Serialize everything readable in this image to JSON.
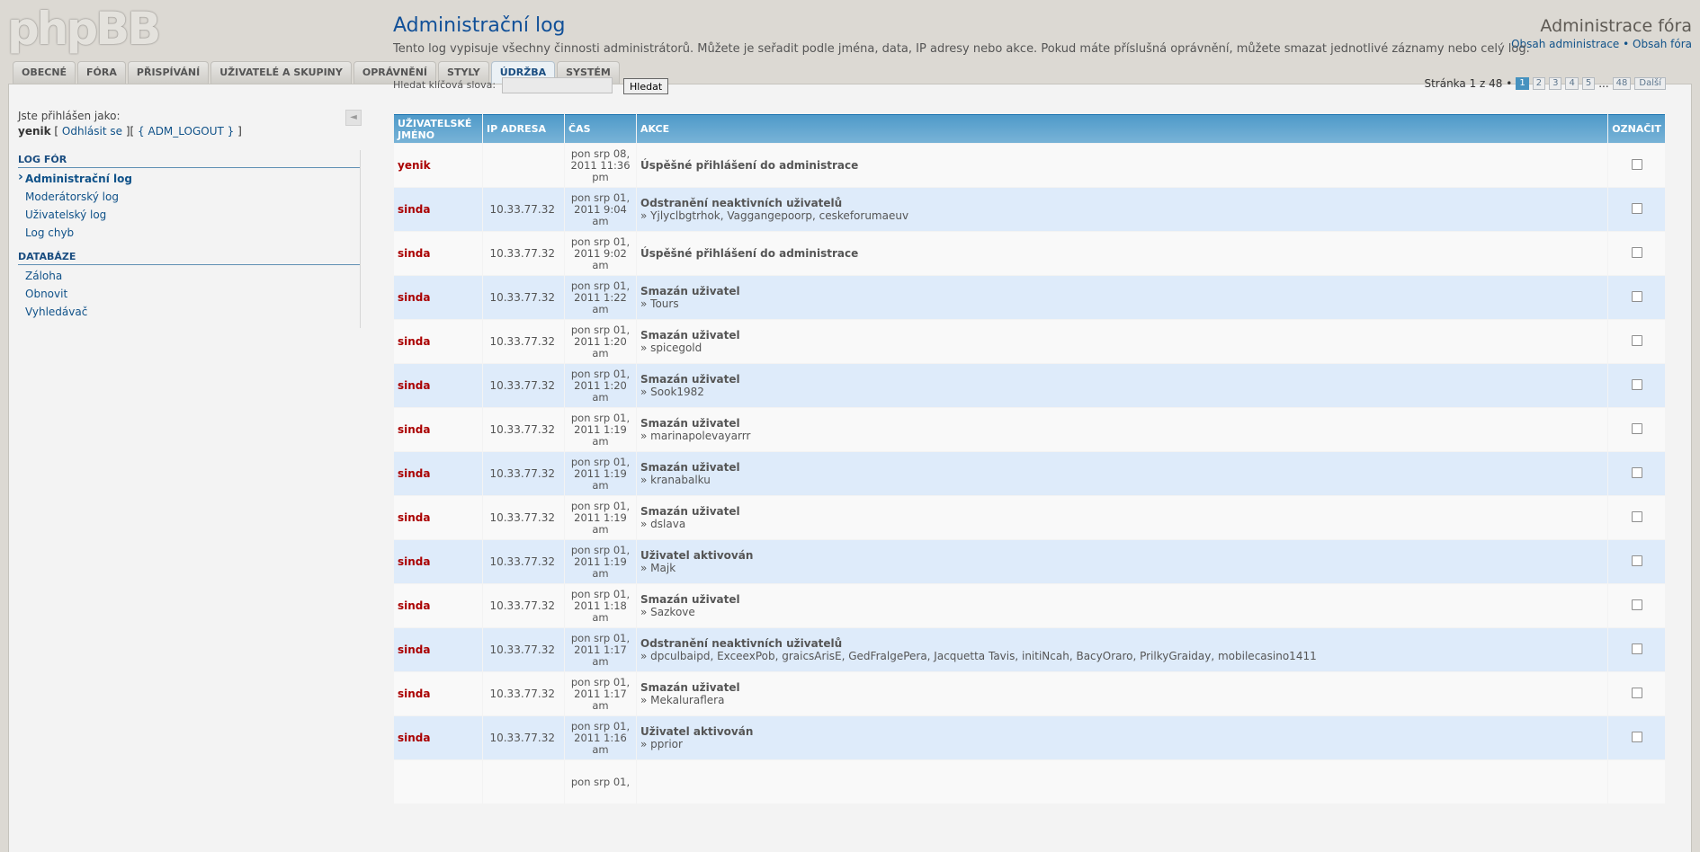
{
  "header": {
    "logo": "phpBB",
    "site_title": "Administrace fóra",
    "link_admin_index": "Obsah administrace",
    "separator": "•",
    "link_board_index": "Obsah fóra"
  },
  "tabs": [
    {
      "label": "OBECNÉ"
    },
    {
      "label": "FÓRA"
    },
    {
      "label": "PŘISPÍVÁNÍ"
    },
    {
      "label": "UŽIVATELÉ A SKUPINY"
    },
    {
      "label": "OPRÁVNĚNÍ"
    },
    {
      "label": "STYLY"
    },
    {
      "label": "ÚDRŽBA"
    },
    {
      "label": "SYSTÉM"
    }
  ],
  "sidebar": {
    "logged_in_label": "Jste přihlášen jako:",
    "username": "yenik",
    "logout_open": " [ ",
    "logout_link": "Odhlásit se",
    "logout_mid": " ][ ",
    "adm_logout": "{ ADM_LOGOUT }",
    "logout_close": " ]",
    "collapse_glyph": "◄",
    "sections": [
      {
        "title": "LOG FÓR",
        "items": [
          {
            "label": "Administrační log"
          },
          {
            "label": "Moderátorský log"
          },
          {
            "label": "Uživatelský log"
          },
          {
            "label": "Log chyb"
          }
        ]
      },
      {
        "title": "DATABÁZE",
        "items": [
          {
            "label": "Záloha"
          },
          {
            "label": "Obnovit"
          },
          {
            "label": "Vyhledávač"
          }
        ]
      }
    ]
  },
  "main": {
    "title": "Administrační log",
    "description": "Tento log vypisuje všechny činnosti administrátorů. Můžete je seřadit podle jména, data, IP adresy nebo akce. Pokud máte příslušná oprávnění, můžete smazat jednotlivé záznamy nebo celý log.",
    "search_label": "Hledat klíčová slova:",
    "search_value": "",
    "search_button": "Hledat",
    "pagination": {
      "text": "Stránka 1 z 48 •",
      "pages": [
        "1",
        "2",
        "3",
        "4",
        "5"
      ],
      "ellipsis": "...",
      "last": "48",
      "next": "Další"
    }
  },
  "table": {
    "headers": {
      "user": "UŽIVATELSKÉ JMÉNO",
      "ip": "IP ADRESA",
      "time": "ČAS",
      "action": "AKCE",
      "mark": "OZNAČIT"
    },
    "rows": [
      {
        "user": "yenik",
        "ip": "",
        "time": "pon srp 08, 2011 11:36 pm",
        "action": "Úspěšné přihlášení do administrace",
        "detail": ""
      },
      {
        "user": "sinda",
        "ip": "10.33.77.32",
        "time": "pon srp 01, 2011 9:04 am",
        "action": "Odstranění neaktivních uživatelů",
        "detail": "» Yjlyclbgtrhok, Vaggangepoorp, ceskeforumaeuv"
      },
      {
        "user": "sinda",
        "ip": "10.33.77.32",
        "time": "pon srp 01, 2011 9:02 am",
        "action": "Úspěšné přihlášení do administrace",
        "detail": ""
      },
      {
        "user": "sinda",
        "ip": "10.33.77.32",
        "time": "pon srp 01, 2011 1:22 am",
        "action": "Smazán uživatel",
        "detail": "» Tours"
      },
      {
        "user": "sinda",
        "ip": "10.33.77.32",
        "time": "pon srp 01, 2011 1:20 am",
        "action": "Smazán uživatel",
        "detail": "» spicegold"
      },
      {
        "user": "sinda",
        "ip": "10.33.77.32",
        "time": "pon srp 01, 2011 1:20 am",
        "action": "Smazán uživatel",
        "detail": "» Sook1982"
      },
      {
        "user": "sinda",
        "ip": "10.33.77.32",
        "time": "pon srp 01, 2011 1:19 am",
        "action": "Smazán uživatel",
        "detail": "» marinapolevayarrr"
      },
      {
        "user": "sinda",
        "ip": "10.33.77.32",
        "time": "pon srp 01, 2011 1:19 am",
        "action": "Smazán uživatel",
        "detail": "» kranabalku"
      },
      {
        "user": "sinda",
        "ip": "10.33.77.32",
        "time": "pon srp 01, 2011 1:19 am",
        "action": "Smazán uživatel",
        "detail": "» dslava"
      },
      {
        "user": "sinda",
        "ip": "10.33.77.32",
        "time": "pon srp 01, 2011 1:19 am",
        "action": "Uživatel aktivován",
        "detail": "» Majk"
      },
      {
        "user": "sinda",
        "ip": "10.33.77.32",
        "time": "pon srp 01, 2011 1:18 am",
        "action": "Smazán uživatel",
        "detail": "» Sazkove"
      },
      {
        "user": "sinda",
        "ip": "10.33.77.32",
        "time": "pon srp 01, 2011 1:17 am",
        "action": "Odstranění neaktivních uživatelů",
        "detail": "» dpculbaipd, ExceexPob, graicsArisE, GedFralgePera, Jacquetta Tavis, initiNcah, BacyOraro, PrilkyGraiday, mobilecasino1411"
      },
      {
        "user": "sinda",
        "ip": "10.33.77.32",
        "time": "pon srp 01, 2011 1:17 am",
        "action": "Smazán uživatel",
        "detail": "» Mekaluraflera"
      },
      {
        "user": "sinda",
        "ip": "10.33.77.32",
        "time": "pon srp 01, 2011 1:16 am",
        "action": "Uživatel aktivován",
        "detail": "» pprior"
      },
      {
        "user": "",
        "ip": "",
        "time": "pon srp 01,",
        "action": "",
        "detail": ""
      }
    ]
  },
  "colors": {
    "accent_blue": "#105289",
    "header_blue": "#4f9ac9",
    "username_red": "#aa0000",
    "row_alt": "#deebfa"
  }
}
